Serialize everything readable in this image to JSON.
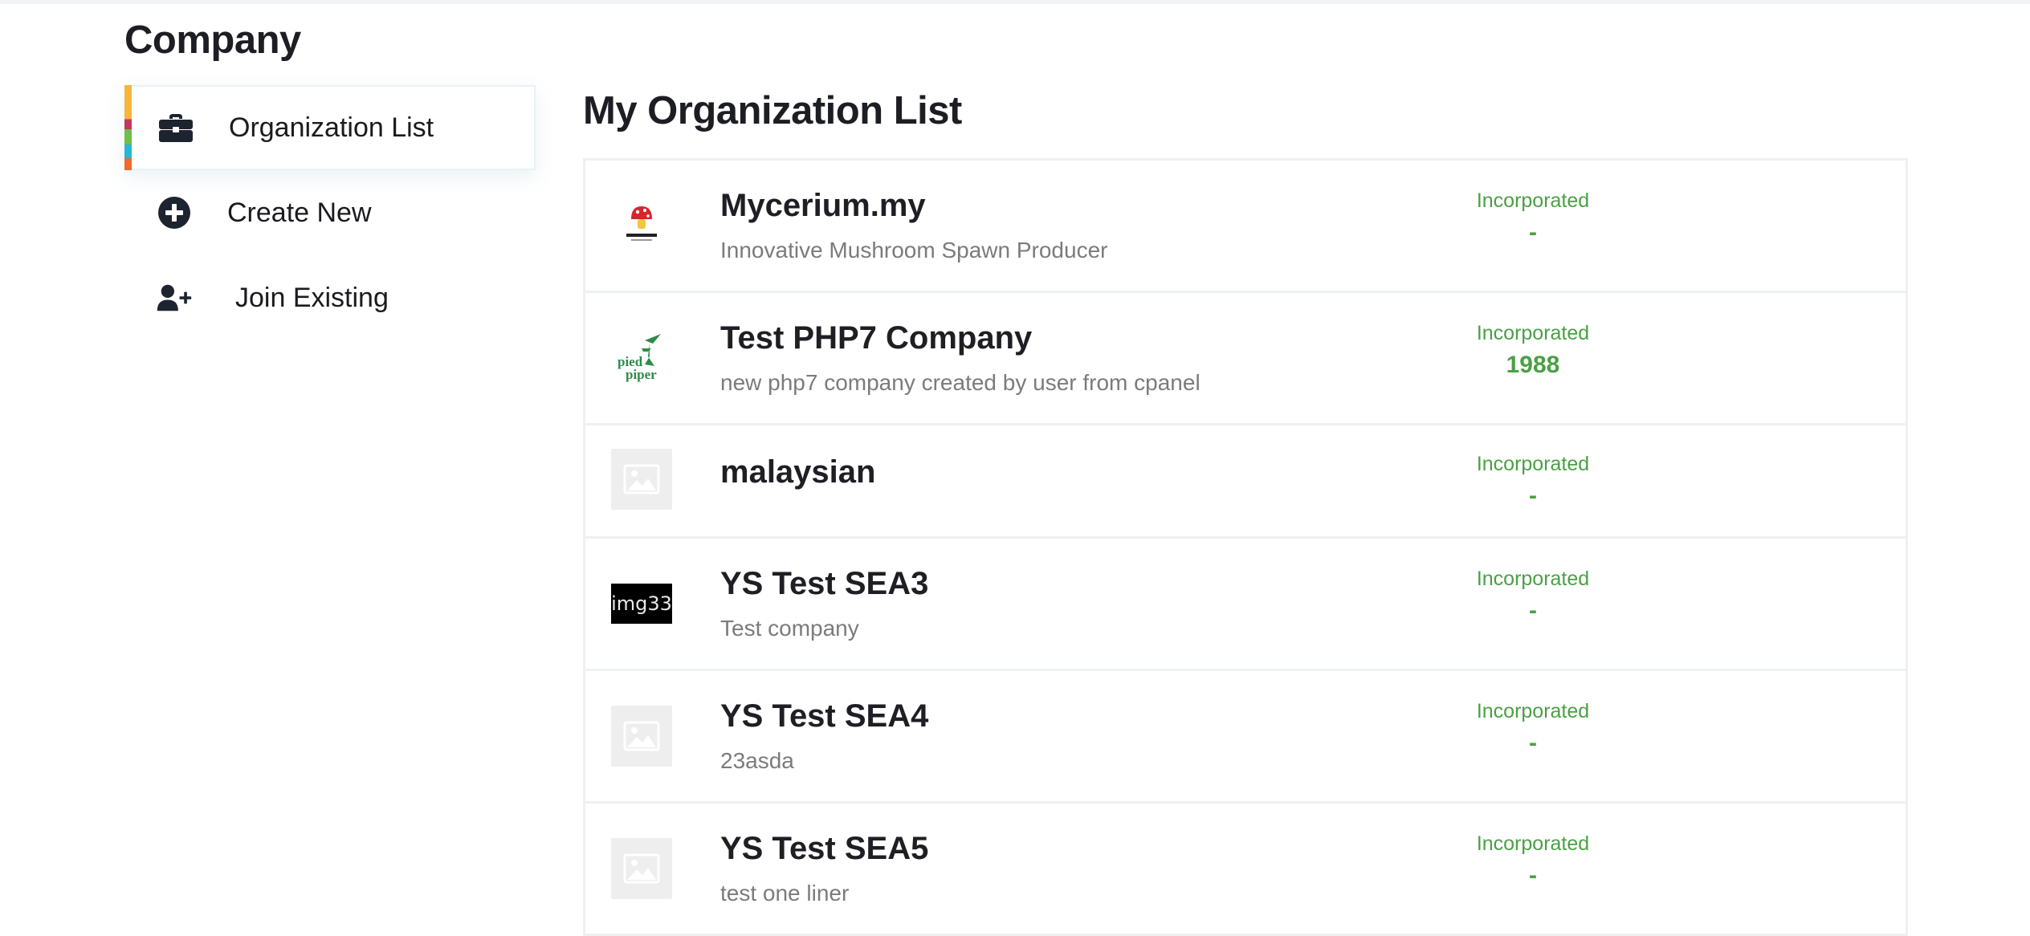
{
  "page": {
    "title": "Company",
    "list_heading": "My Organization List"
  },
  "sidebar": {
    "items": [
      {
        "label": "Organization List",
        "icon": "briefcase-icon",
        "active": true
      },
      {
        "label": "Create New",
        "icon": "plus-circle-icon",
        "active": false
      },
      {
        "label": "Join Existing",
        "icon": "user-plus-icon",
        "active": false
      }
    ]
  },
  "organizations": [
    {
      "name": "Mycerium.my",
      "description": "Innovative Mushroom Spawn Producer",
      "status": "Incorporated",
      "year": "-",
      "logo": "mushroom-logo"
    },
    {
      "name": "Test PHP7 Company",
      "description": "new php7 company created by user from cpanel",
      "status": "Incorporated",
      "year": "1988",
      "logo": "pied-piper-logo"
    },
    {
      "name": "malaysian",
      "description": "",
      "status": "Incorporated",
      "year": "-",
      "logo": "placeholder-image-icon"
    },
    {
      "name": "YS Test SEA3",
      "description": "Test company",
      "status": "Incorporated",
      "year": "-",
      "logo": "img33",
      "logo_text": "img33"
    },
    {
      "name": "YS Test SEA4",
      "description": "23asda",
      "status": "Incorporated",
      "year": "-",
      "logo": "placeholder-image-icon"
    },
    {
      "name": "YS Test SEA5",
      "description": "test one liner",
      "status": "Incorporated",
      "year": "-",
      "logo": "placeholder-image-icon"
    }
  ],
  "colors": {
    "status_green": "#4aa045",
    "heading": "#1d1d24",
    "muted_text": "#7b7b7b"
  }
}
